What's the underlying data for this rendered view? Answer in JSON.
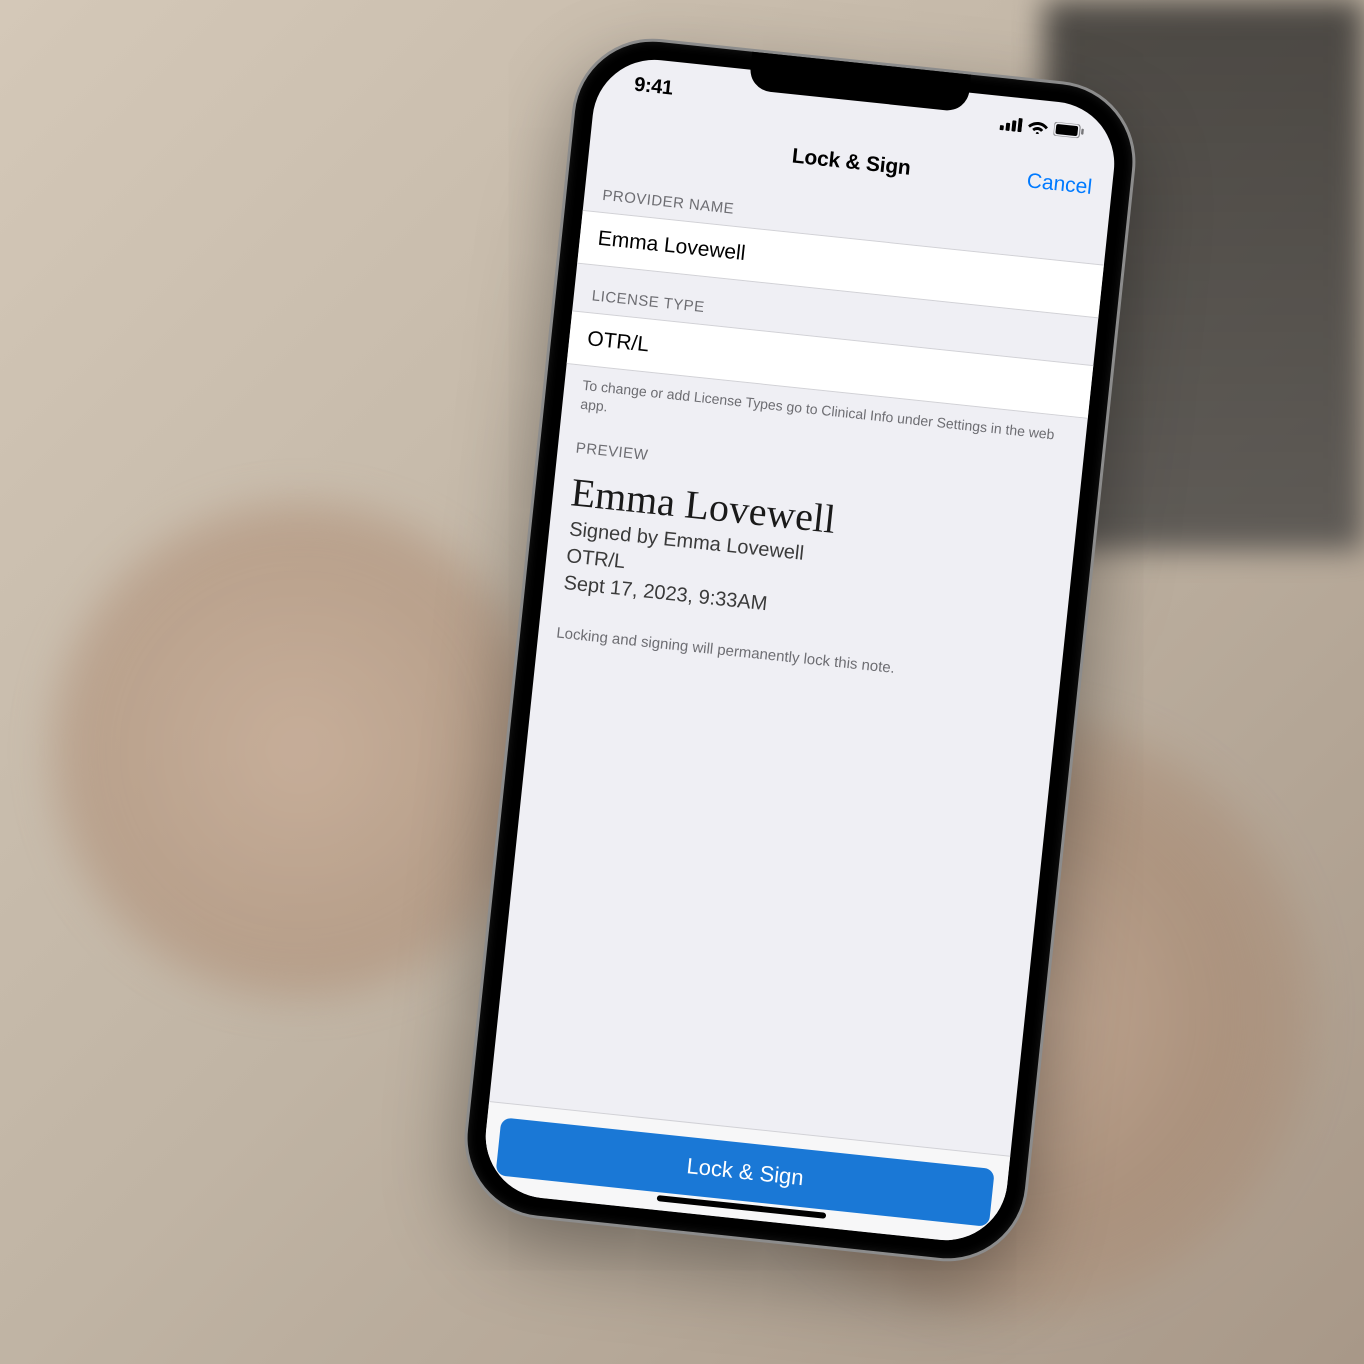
{
  "status": {
    "time": "9:41"
  },
  "nav": {
    "title": "Lock & Sign",
    "cancel": "Cancel"
  },
  "sections": {
    "provider_label": "PROVIDER NAME",
    "provider_value": "Emma Lovewell",
    "license_label": "LICENSE TYPE",
    "license_value": "OTR/L",
    "license_help": "To change or add License Types go to Clinical Info under Settings in the web app.",
    "preview_label": "PREVIEW"
  },
  "preview": {
    "signature": "Emma Lovewell",
    "signed_by": "Signed by Emma Lovewell",
    "credential": "OTR/L",
    "timestamp": "Sept 17, 2023, 9:33AM"
  },
  "warning": "Locking and signing will permanently lock this note.",
  "button": {
    "primary": "Lock & Sign"
  }
}
